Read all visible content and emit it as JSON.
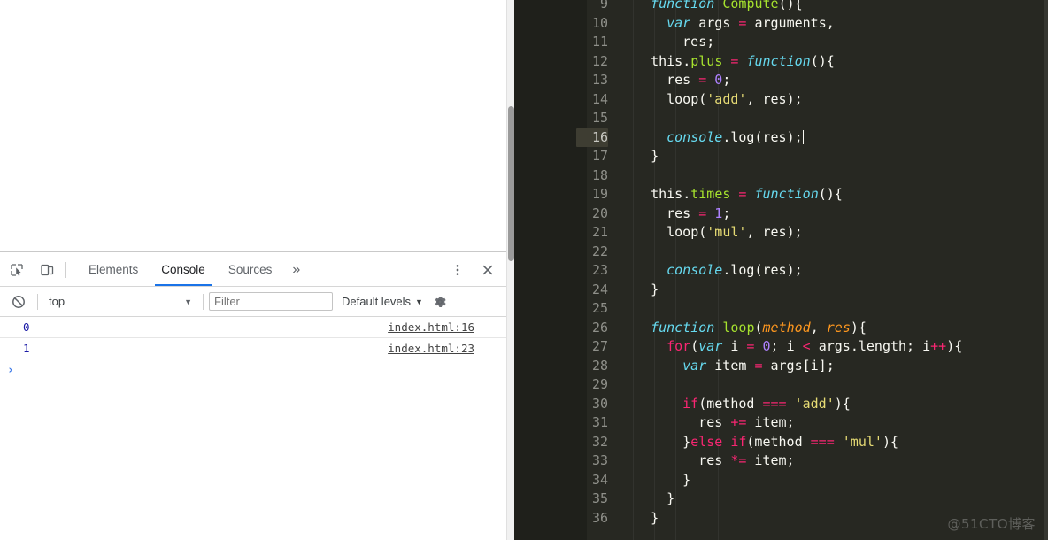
{
  "window": {
    "page_area_empty": true
  },
  "devtools": {
    "toolbar": {
      "inspect_icon": "inspect-cursor-icon",
      "device_icon": "device-toolbar-icon",
      "more_icon": "kebab-menu-icon",
      "close_icon": "close-icon"
    },
    "tabs": [
      {
        "label": "Elements",
        "active": false
      },
      {
        "label": "Console",
        "active": true
      },
      {
        "label": "Sources",
        "active": false
      }
    ],
    "tabs_overflow_label": "»",
    "filterbar": {
      "clear_icon": "clear-console-icon",
      "context": "top",
      "context_arrow": "▼",
      "filter_placeholder": "Filter",
      "filter_value": "",
      "levels": "Default levels",
      "levels_arrow": "▼",
      "settings_icon": "gear-icon"
    },
    "messages": [
      {
        "value": "0",
        "source": "index.html:16"
      },
      {
        "value": "1",
        "source": "index.html:23"
      }
    ],
    "prompt_symbol": "›"
  },
  "editor": {
    "watermark": "@51CTO博客",
    "current_line": 16,
    "lines": [
      {
        "n": "9",
        "indent": 2,
        "tokens": [
          {
            "t": "function",
            "c": "kw"
          },
          {
            "t": " ",
            "c": "pl"
          },
          {
            "t": "Compute",
            "c": "fn"
          },
          {
            "t": "(){",
            "c": "pl"
          }
        ]
      },
      {
        "n": "10",
        "indent": 3,
        "tokens": [
          {
            "t": "var",
            "c": "kw"
          },
          {
            "t": " args ",
            "c": "pl"
          },
          {
            "t": "=",
            "c": "k"
          },
          {
            "t": " arguments,",
            "c": "pl"
          }
        ]
      },
      {
        "n": "11",
        "indent": 4,
        "tokens": [
          {
            "t": "res;",
            "c": "pl"
          }
        ]
      },
      {
        "n": "12",
        "indent": 2,
        "tokens": [
          {
            "t": "this.",
            "c": "pl"
          },
          {
            "t": "plus",
            "c": "fn"
          },
          {
            "t": " ",
            "c": "pl"
          },
          {
            "t": "=",
            "c": "k"
          },
          {
            "t": " ",
            "c": "pl"
          },
          {
            "t": "function",
            "c": "kw"
          },
          {
            "t": "(){",
            "c": "pl"
          }
        ]
      },
      {
        "n": "13",
        "indent": 3,
        "tokens": [
          {
            "t": "res ",
            "c": "pl"
          },
          {
            "t": "=",
            "c": "k"
          },
          {
            "t": " ",
            "c": "pl"
          },
          {
            "t": "0",
            "c": "num"
          },
          {
            "t": ";",
            "c": "pl"
          }
        ]
      },
      {
        "n": "14",
        "indent": 3,
        "tokens": [
          {
            "t": "loop(",
            "c": "pl"
          },
          {
            "t": "'add'",
            "c": "str"
          },
          {
            "t": ", res);",
            "c": "pl"
          }
        ]
      },
      {
        "n": "15",
        "indent": 0,
        "tokens": []
      },
      {
        "n": "16",
        "indent": 3,
        "tokens": [
          {
            "t": "console",
            "c": "obj"
          },
          {
            "t": ".log(res);",
            "c": "pl"
          }
        ],
        "caret": true
      },
      {
        "n": "17",
        "indent": 2,
        "tokens": [
          {
            "t": "}",
            "c": "pl"
          }
        ]
      },
      {
        "n": "18",
        "indent": 0,
        "tokens": []
      },
      {
        "n": "19",
        "indent": 2,
        "tokens": [
          {
            "t": "this.",
            "c": "pl"
          },
          {
            "t": "times",
            "c": "fn"
          },
          {
            "t": " ",
            "c": "pl"
          },
          {
            "t": "=",
            "c": "k"
          },
          {
            "t": " ",
            "c": "pl"
          },
          {
            "t": "function",
            "c": "kw"
          },
          {
            "t": "(){",
            "c": "pl"
          }
        ]
      },
      {
        "n": "20",
        "indent": 3,
        "tokens": [
          {
            "t": "res ",
            "c": "pl"
          },
          {
            "t": "=",
            "c": "k"
          },
          {
            "t": " ",
            "c": "pl"
          },
          {
            "t": "1",
            "c": "num"
          },
          {
            "t": ";",
            "c": "pl"
          }
        ]
      },
      {
        "n": "21",
        "indent": 3,
        "tokens": [
          {
            "t": "loop(",
            "c": "pl"
          },
          {
            "t": "'mul'",
            "c": "str"
          },
          {
            "t": ", res);",
            "c": "pl"
          }
        ]
      },
      {
        "n": "22",
        "indent": 0,
        "tokens": []
      },
      {
        "n": "23",
        "indent": 3,
        "tokens": [
          {
            "t": "console",
            "c": "obj"
          },
          {
            "t": ".log(res);",
            "c": "pl"
          }
        ]
      },
      {
        "n": "24",
        "indent": 2,
        "tokens": [
          {
            "t": "}",
            "c": "pl"
          }
        ]
      },
      {
        "n": "25",
        "indent": 0,
        "tokens": []
      },
      {
        "n": "26",
        "indent": 2,
        "tokens": [
          {
            "t": "function",
            "c": "kw"
          },
          {
            "t": " ",
            "c": "pl"
          },
          {
            "t": "loop",
            "c": "fn"
          },
          {
            "t": "(",
            "c": "pl"
          },
          {
            "t": "method",
            "c": "par"
          },
          {
            "t": ", ",
            "c": "pl"
          },
          {
            "t": "res",
            "c": "par"
          },
          {
            "t": "){",
            "c": "pl"
          }
        ]
      },
      {
        "n": "27",
        "indent": 3,
        "tokens": [
          {
            "t": "for",
            "c": "k"
          },
          {
            "t": "(",
            "c": "pl"
          },
          {
            "t": "var",
            "c": "kw"
          },
          {
            "t": " i ",
            "c": "pl"
          },
          {
            "t": "=",
            "c": "k"
          },
          {
            "t": " ",
            "c": "pl"
          },
          {
            "t": "0",
            "c": "num"
          },
          {
            "t": "; i ",
            "c": "pl"
          },
          {
            "t": "<",
            "c": "k"
          },
          {
            "t": " args.length; i",
            "c": "pl"
          },
          {
            "t": "++",
            "c": "k"
          },
          {
            "t": "){",
            "c": "pl"
          }
        ]
      },
      {
        "n": "28",
        "indent": 4,
        "tokens": [
          {
            "t": "var",
            "c": "kw"
          },
          {
            "t": " item ",
            "c": "pl"
          },
          {
            "t": "=",
            "c": "k"
          },
          {
            "t": " args[i];",
            "c": "pl"
          }
        ]
      },
      {
        "n": "29",
        "indent": 0,
        "tokens": []
      },
      {
        "n": "30",
        "indent": 4,
        "tokens": [
          {
            "t": "if",
            "c": "k"
          },
          {
            "t": "(method ",
            "c": "pl"
          },
          {
            "t": "===",
            "c": "k"
          },
          {
            "t": " ",
            "c": "pl"
          },
          {
            "t": "'add'",
            "c": "str"
          },
          {
            "t": "){",
            "c": "pl"
          }
        ]
      },
      {
        "n": "31",
        "indent": 5,
        "tokens": [
          {
            "t": "res ",
            "c": "pl"
          },
          {
            "t": "+=",
            "c": "k"
          },
          {
            "t": " item;",
            "c": "pl"
          }
        ]
      },
      {
        "n": "32",
        "indent": 4,
        "tokens": [
          {
            "t": "}",
            "c": "pl"
          },
          {
            "t": "else",
            "c": "k"
          },
          {
            "t": " ",
            "c": "pl"
          },
          {
            "t": "if",
            "c": "k"
          },
          {
            "t": "(method ",
            "c": "pl"
          },
          {
            "t": "===",
            "c": "k"
          },
          {
            "t": " ",
            "c": "pl"
          },
          {
            "t": "'mul'",
            "c": "str"
          },
          {
            "t": "){",
            "c": "pl"
          }
        ]
      },
      {
        "n": "33",
        "indent": 5,
        "tokens": [
          {
            "t": "res ",
            "c": "pl"
          },
          {
            "t": "*=",
            "c": "k"
          },
          {
            "t": " item;",
            "c": "pl"
          }
        ]
      },
      {
        "n": "34",
        "indent": 4,
        "tokens": [
          {
            "t": "}",
            "c": "pl"
          }
        ]
      },
      {
        "n": "35",
        "indent": 3,
        "tokens": [
          {
            "t": "}",
            "c": "pl"
          }
        ]
      },
      {
        "n": "36",
        "indent": 2,
        "tokens": [
          {
            "t": "}",
            "c": "pl"
          }
        ]
      }
    ]
  }
}
